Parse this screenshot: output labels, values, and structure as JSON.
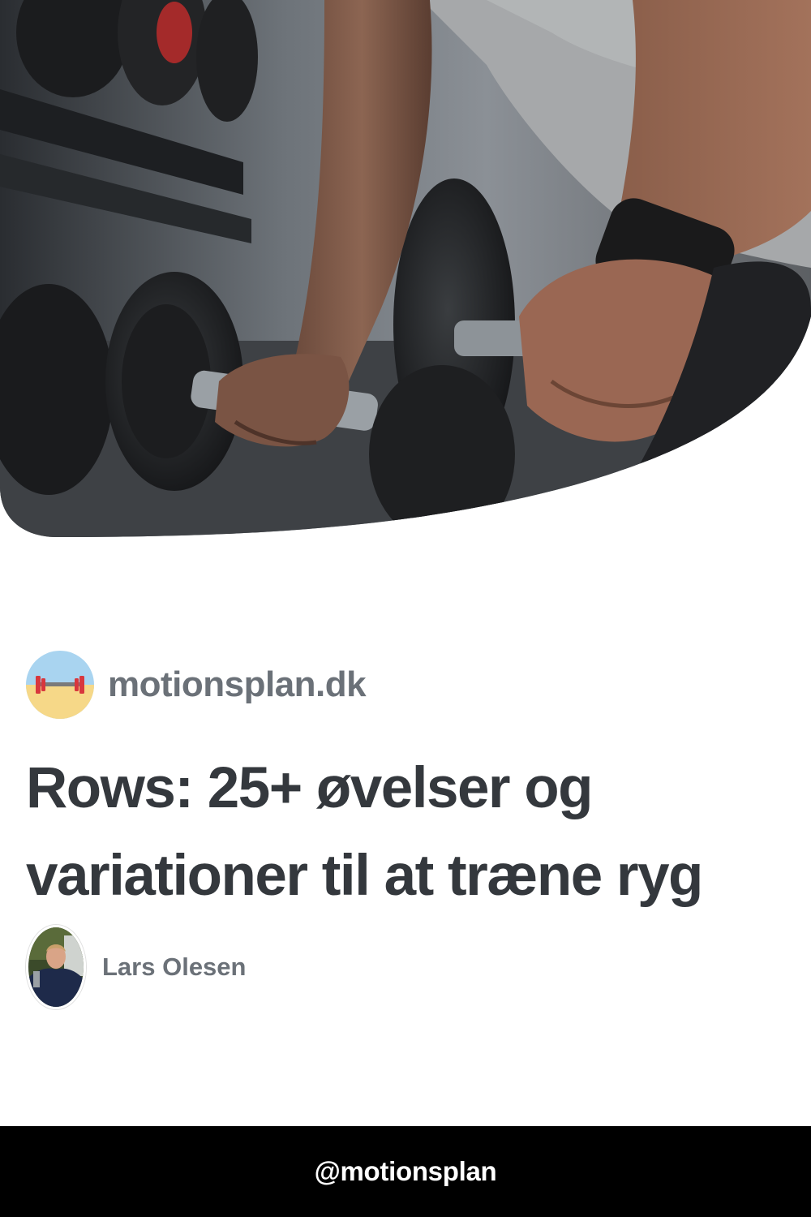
{
  "hero": {
    "image": "gym-dumbbell-rack-photo"
  },
  "site": {
    "logo_icon": "dumbbell-icon",
    "name": "motionsplan.dk"
  },
  "article": {
    "title_lines": [
      "Rows: 25+ øvelser og",
      "variationer til at træne ryg"
    ]
  },
  "author": {
    "avatar": "author-portrait",
    "name": "Lars Olesen"
  },
  "footer": {
    "handle": "@motionsplan"
  },
  "colors": {
    "text_title": "#34383d",
    "text_muted": "#6b7178",
    "footer_bg": "#000000",
    "footer_text": "#ffffff"
  }
}
